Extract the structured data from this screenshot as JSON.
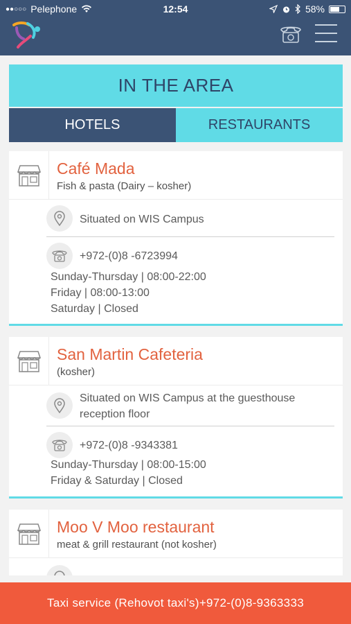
{
  "status": {
    "carrier": "Pelephone",
    "time": "12:54",
    "battery": "58%"
  },
  "header": {
    "logo": "app-logo",
    "phone_icon": "phone-icon",
    "menu_icon": "hamburger-menu-icon"
  },
  "page": {
    "title": "IN THE AREA",
    "tabs": [
      {
        "label": "HOTELS",
        "active": false
      },
      {
        "label": "RESTAURANTS",
        "active": true
      }
    ]
  },
  "restaurants": [
    {
      "name": "Café Mada",
      "subtitle": "Fish & pasta (Dairy – kosher)",
      "location": "Situated on WIS Campus",
      "phone": "+972-(0)8 -6723994",
      "hours": [
        "Sunday-Thursday | 08:00-22:00",
        "Friday | 08:00-13:00",
        "Saturday | Closed"
      ]
    },
    {
      "name": "San Martin Cafeteria",
      "subtitle": "(kosher)",
      "location_line1": "Situated on WIS Campus at the guesthouse",
      "location_line2": "reception floor",
      "phone": "+972-(0)8 -9343381",
      "hours": [
        "Sunday-Thursday | 08:00-15:00",
        "Friday & Saturday | Closed"
      ]
    },
    {
      "name": "Moo V Moo restaurant",
      "subtitle": "meat & grill restaurant (not kosher)"
    }
  ],
  "footer": {
    "text": "Taxi service (Rehovot taxi's)+972-(0)8-9363333"
  },
  "colors": {
    "navy": "#3b5375",
    "cyan": "#60dbe6",
    "accent_orange": "#e2623f",
    "footer_red": "#f05a3c"
  }
}
